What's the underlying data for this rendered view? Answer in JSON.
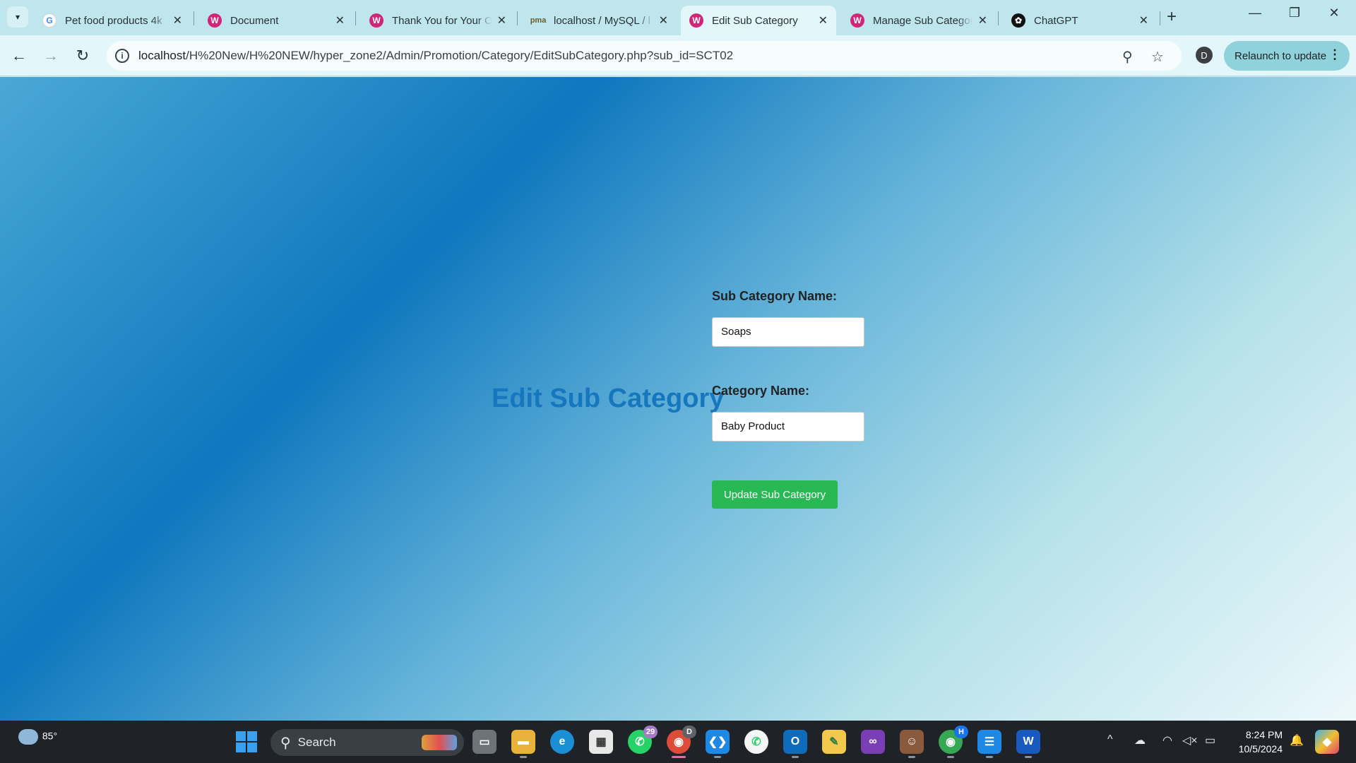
{
  "browser": {
    "tabs": [
      {
        "title": "Pet food products 4k",
        "icon": "google-icon",
        "active": false
      },
      {
        "title": "Document",
        "icon": "wordpress-icon",
        "active": false
      },
      {
        "title": "Thank You for Your O",
        "icon": "wordpress-icon",
        "active": false
      },
      {
        "title": "localhost / MySQL / l",
        "icon": "phpmyadmin-icon",
        "active": false
      },
      {
        "title": "Edit Sub Category",
        "icon": "wordpress-icon",
        "active": true
      },
      {
        "title": "Manage Sub Categor",
        "icon": "wordpress-icon",
        "active": false
      },
      {
        "title": "ChatGPT",
        "icon": "chatgpt-icon",
        "active": false
      }
    ],
    "url_host": "localhost",
    "url_path": "/H%20New/H%20NEW/hyper_zone2/Admin/Promotion/Category/EditSubCategory.php?sub_id=SCT02",
    "profile_initial": "D",
    "relaunch_label": "Relaunch to update"
  },
  "page": {
    "heading": "Edit Sub Category",
    "sub_category_label": "Sub Category Name:",
    "sub_category_value": "Soaps",
    "category_label": "Category Name:",
    "category_value": "Baby Product",
    "submit_label": "Update Sub Category"
  },
  "taskbar": {
    "weather_temp": "85°",
    "search_label": "Search",
    "whatsapp_badge": "29",
    "chrome_profile_badge": "D",
    "chrome2_profile_badge": "H",
    "time": "8:24 PM",
    "date": "10/5/2024"
  },
  "colors": {
    "heading": "#1677be",
    "submit_button": "#28b854",
    "active_tab": "#e3f6f9",
    "tab_strip": "#bfe6ec"
  }
}
